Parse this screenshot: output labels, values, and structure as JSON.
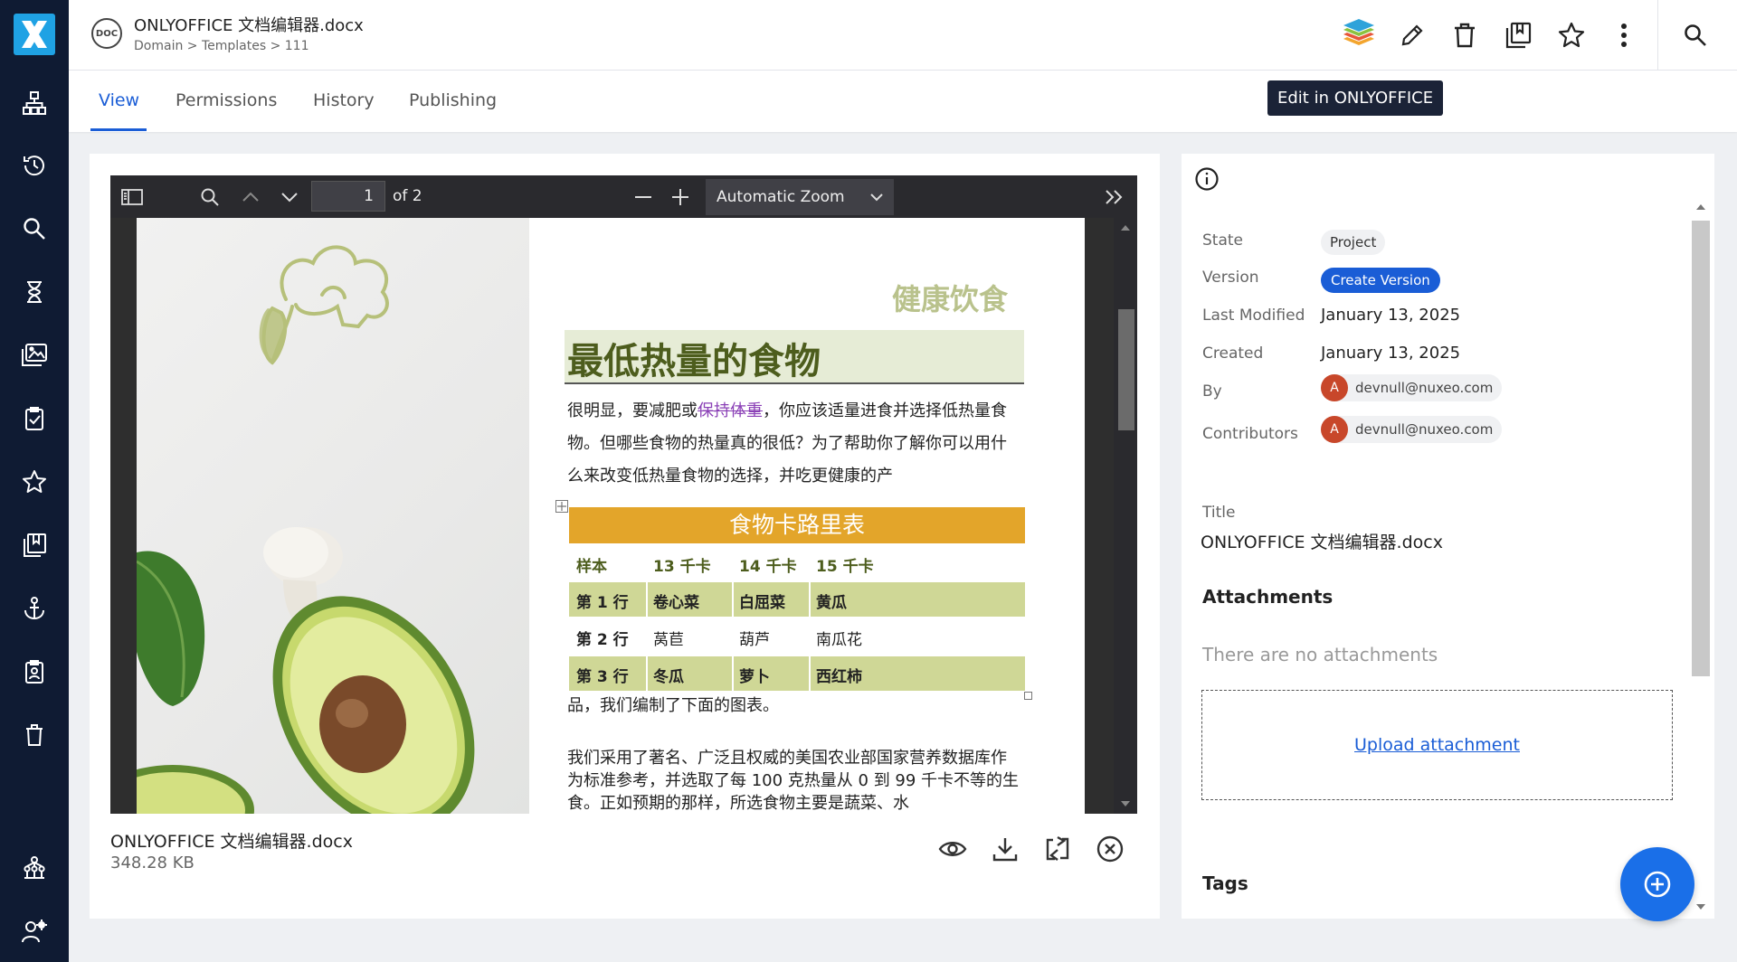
{
  "app": {
    "accent": "#1a5dd6",
    "rail_color": "#0f1b33"
  },
  "rail": {
    "logo": "nuxeo-x-logo",
    "items": [
      {
        "icon": "hierarchy-icon"
      },
      {
        "icon": "history-icon"
      },
      {
        "icon": "search-icon"
      },
      {
        "icon": "hourglass-icon"
      },
      {
        "icon": "gallery-icon"
      },
      {
        "icon": "tasks-icon"
      },
      {
        "icon": "star-icon"
      },
      {
        "icon": "collections-icon"
      },
      {
        "icon": "anchor-icon"
      },
      {
        "icon": "clipboard-user-icon"
      },
      {
        "icon": "trash-icon"
      },
      {
        "icon": "admin-tree-icon"
      },
      {
        "icon": "user-settings-icon"
      }
    ]
  },
  "header": {
    "badge": "DOC",
    "title": "ONLYOFFICE 文档编辑器.docx",
    "breadcrumb": "Domain > Templates > 111",
    "actions": [
      "onlyoffice-icon",
      "edit-icon",
      "delete-icon",
      "add-to-collection-icon",
      "favorite-icon",
      "more-icon",
      "search-icon"
    ]
  },
  "tabs": [
    {
      "label": "View",
      "active": true
    },
    {
      "label": "Permissions"
    },
    {
      "label": "History"
    },
    {
      "label": "Publishing"
    }
  ],
  "tooltip": "Edit in ONLYOFFICE",
  "viewer": {
    "page_current": "1",
    "page_total": "of 2",
    "zoom": "Automatic Zoom",
    "document": {
      "right_title": "健康饮食",
      "heading": "最低热量的食物",
      "para1_a": "很明显，要减肥或",
      "para1_link": "保持体重",
      "para1_b": "，你应该适量进食并选择低热量食物。但哪些食物的热量真的很低？为了帮助你了解你可以用什么来改变低热量食物的选择，并吃更健康的产",
      "table": {
        "caption": "食物卡路里表",
        "headers": [
          "样本",
          "13 千卡",
          "14 千卡",
          "15 千卡"
        ],
        "rows": [
          [
            "第 1 行",
            "卷心菜",
            "白屈菜",
            "黄瓜"
          ],
          [
            "第 2 行",
            "莴苣",
            "葫芦",
            "南瓜花"
          ],
          [
            "第 3 行",
            "冬瓜",
            "萝卜",
            "西红柿"
          ]
        ]
      },
      "para2": "品，我们编制了下面的图表。",
      "para3": "我们采用了著名、广泛且权威的美国农业部国家营养数据库作为标准参考，并选取了每 100 克热量从 0 到 99 千卡不等的生食。正如预期的那样，所选食物主要是蔬菜、水"
    }
  },
  "file": {
    "name": "ONLYOFFICE 文档编辑器.docx",
    "size": "348.28 KB",
    "actions": [
      "preview-icon",
      "download-icon",
      "replace-icon",
      "remove-icon"
    ]
  },
  "side": {
    "labels": {
      "state": "State",
      "version": "Version",
      "last_modified": "Last Modified",
      "created": "Created",
      "by": "By",
      "contributors": "Contributors"
    },
    "state_value": "Project",
    "version_button": "Create Version",
    "last_modified_value": "January 13, 2025",
    "created_value": "January 13, 2025",
    "by_user": {
      "initial": "A",
      "email": "devnull@nuxeo.com"
    },
    "contributor": {
      "initial": "A",
      "email": "devnull@nuxeo.com"
    },
    "title_label": "Title",
    "title_value": "ONLYOFFICE 文档编辑器.docx",
    "attachments_heading": "Attachments",
    "no_attachments": "There are no attachments",
    "upload_link": "Upload attachment",
    "tags_heading": "Tags"
  }
}
